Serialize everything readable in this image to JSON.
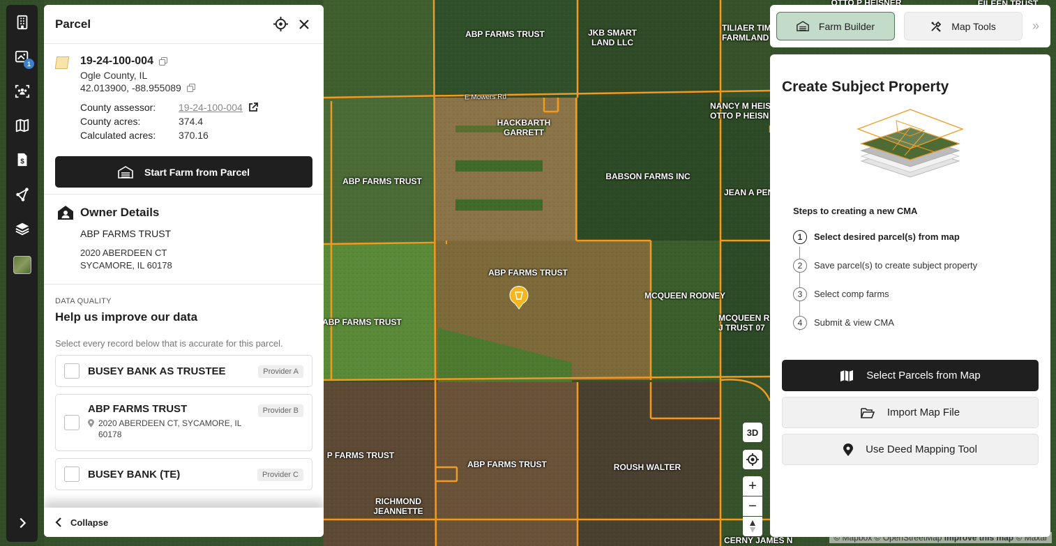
{
  "map": {
    "labels": [
      {
        "text": "ABP FARMS TRUST"
      },
      {
        "text": "JKB SMART\nLAND LLC"
      },
      {
        "text": "TILIAER TIME\nFARMLAND"
      },
      {
        "text": "OTTO P HEISNER"
      },
      {
        "text": "EILEEN TRUST"
      },
      {
        "text": "HACKBARTH\nGARRETT"
      },
      {
        "text": "NANCY M HEISN\nOTTO P HEISN"
      },
      {
        "text": "ABP FARMS TRUST"
      },
      {
        "text": "BABSON FARMS INC"
      },
      {
        "text": "JEAN A PENV"
      },
      {
        "text": "ABP FARMS TRUST"
      },
      {
        "text": "MCQUEEN RODNEY"
      },
      {
        "text": "MCQUEEN RO\nJ TRUST 07"
      },
      {
        "text": "ABP FARMS TRUST"
      },
      {
        "text": "P FARMS TRUST"
      },
      {
        "text": "ABP FARMS TRUST"
      },
      {
        "text": "ROUSH WALTER"
      },
      {
        "text": "RICHMOND\nJEANNETTE"
      },
      {
        "text": "CERNY JAMES N"
      },
      {
        "text": "E Mowers Rd"
      }
    ],
    "attribution": "© Mapbox © OpenStreetMap",
    "attribution_link": "Improve this map",
    "attribution_tail": "© Maxar"
  },
  "rail": {
    "badge_count": "1",
    "icons": [
      "building-icon",
      "map-photo-icon",
      "people-icon",
      "map-icon",
      "document-dollar-icon",
      "route-icon",
      "layers-icon"
    ]
  },
  "parcel": {
    "title": "Parcel",
    "id": "19-24-100-004",
    "county": "Ogle County, IL",
    "coords": "42.013900, -88.955089",
    "assessor_label": "County assessor:",
    "assessor_value": "19-24-100-004",
    "county_acres_label": "County acres:",
    "county_acres_value": "374.4",
    "calc_acres_label": "Calculated acres:",
    "calc_acres_value": "370.16",
    "start_farm_label": "Start Farm from Parcel"
  },
  "owner": {
    "title": "Owner Details",
    "name": "ABP FARMS TRUST",
    "addr1": "2020 ABERDEEN CT",
    "addr2": "SYCAMORE, IL 60178"
  },
  "data_quality": {
    "kicker": "DATA QUALITY",
    "title": "Help us improve our data",
    "description": "Select every record below that is accurate for this parcel.",
    "records": [
      {
        "name": "BUSEY BANK AS TRUSTEE",
        "provider": "Provider A",
        "address": ""
      },
      {
        "name": "ABP FARMS TRUST",
        "provider": "Provider B",
        "address": "2020 ABERDEEN CT, SYCAMORE, IL 60178"
      },
      {
        "name": "BUSEY BANK (TE)",
        "provider": "Provider C",
        "address": ""
      }
    ],
    "collapse_label": "Collapse"
  },
  "toolbar": {
    "farm_builder": "Farm Builder",
    "map_tools": "Map Tools",
    "more": "»"
  },
  "cma": {
    "title": "Create Subject Property",
    "steps_title": "Steps to creating a new CMA",
    "steps": [
      {
        "num": "1",
        "label": "Select desired parcel(s) from map"
      },
      {
        "num": "2",
        "label": "Save parcel(s) to create subject property"
      },
      {
        "num": "3",
        "label": "Select comp farms"
      },
      {
        "num": "4",
        "label": "Submit & view CMA"
      }
    ],
    "select_parcels": "Select Parcels from Map",
    "import_map": "Import Map File",
    "deed_tool": "Use Deed Mapping Tool"
  },
  "map_controls": {
    "three_d": "3D",
    "zoom_in": "+",
    "zoom_out": "−"
  },
  "colors": {
    "parcel_line": "#f39a1f",
    "rail_bg": "#1f1f1f",
    "farm_builder_bg": "#c3dcc9",
    "marker": "#f5b51c"
  }
}
